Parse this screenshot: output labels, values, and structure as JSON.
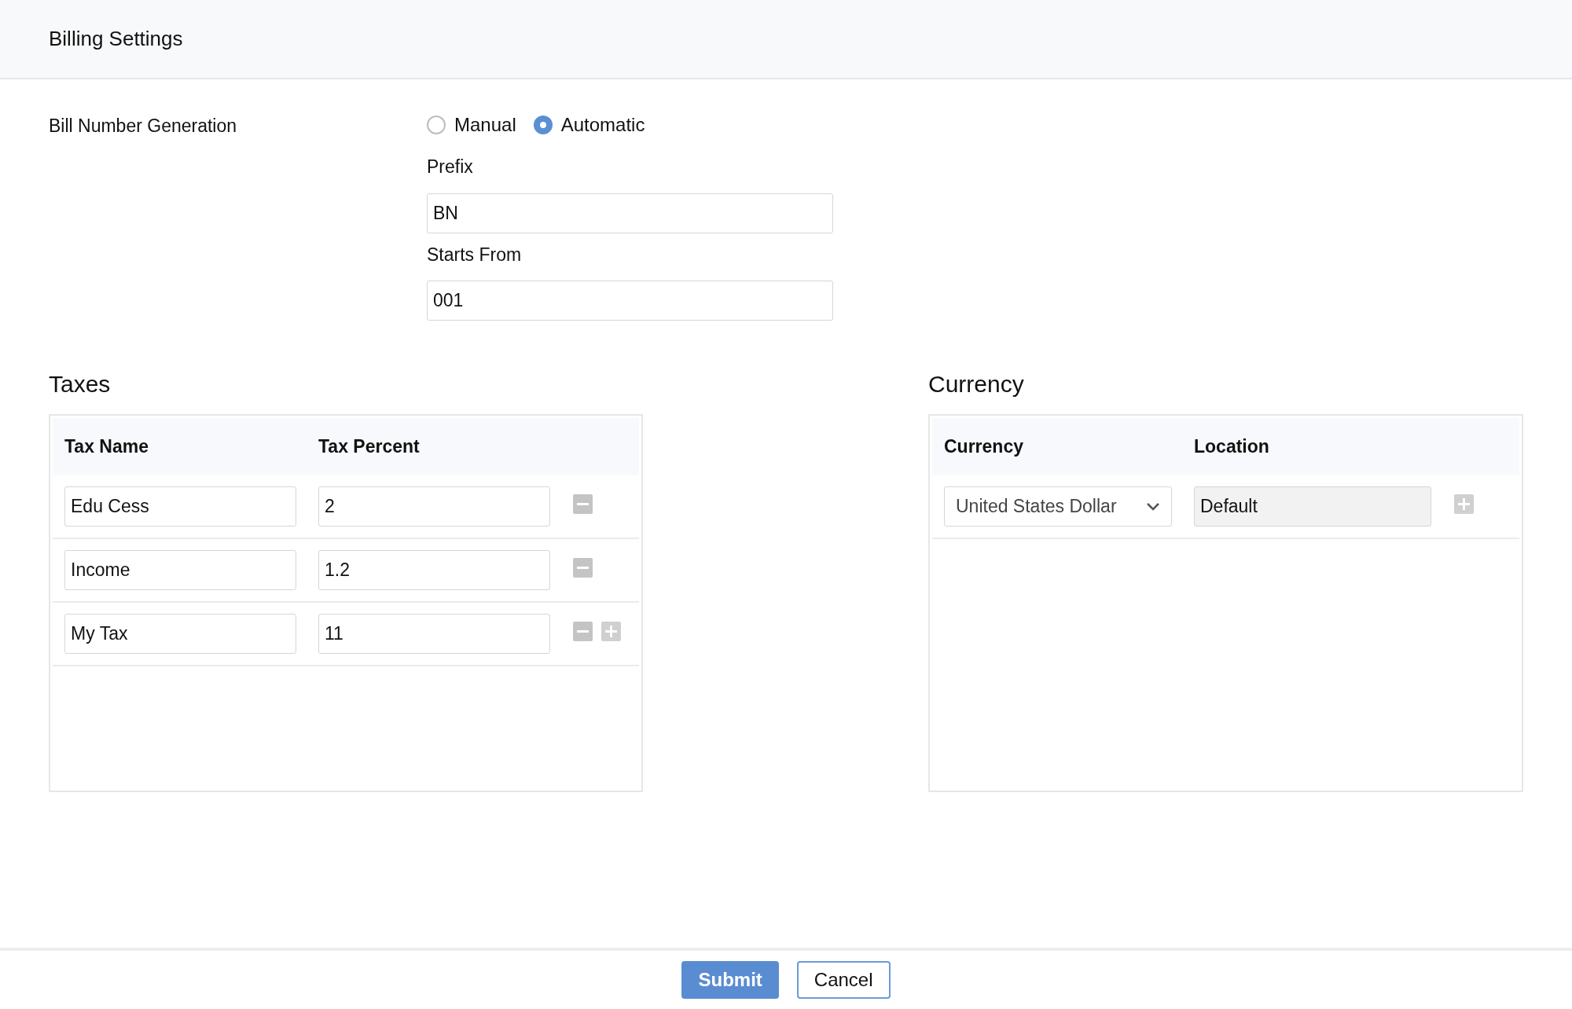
{
  "header": {
    "title": "Billing Settings"
  },
  "bill_number": {
    "label": "Bill Number Generation",
    "options": [
      {
        "label": "Manual",
        "selected": false
      },
      {
        "label": "Automatic",
        "selected": true
      }
    ],
    "fields": [
      {
        "label": "Prefix",
        "value": "BN"
      },
      {
        "label": "Starts From",
        "value": "001"
      }
    ]
  },
  "taxes": {
    "title": "Taxes",
    "columns": [
      "Tax Name",
      "Tax Percent"
    ],
    "rows": [
      {
        "name": "Edu Cess",
        "percent": "2",
        "removable": true,
        "addable": false
      },
      {
        "name": "Income",
        "percent": "1.2",
        "removable": true,
        "addable": false
      },
      {
        "name": "My Tax",
        "percent": "11",
        "removable": true,
        "addable": true
      }
    ]
  },
  "currency": {
    "title": "Currency",
    "columns": [
      "Currency",
      "Location"
    ],
    "rows": [
      {
        "currency": "United States Dollar",
        "location": "Default",
        "location_disabled": true,
        "removable": false,
        "addable": true
      }
    ]
  },
  "buttons": [
    {
      "label": "Submit",
      "kind": "primary"
    },
    {
      "label": "Cancel",
      "kind": "secondary"
    }
  ]
}
